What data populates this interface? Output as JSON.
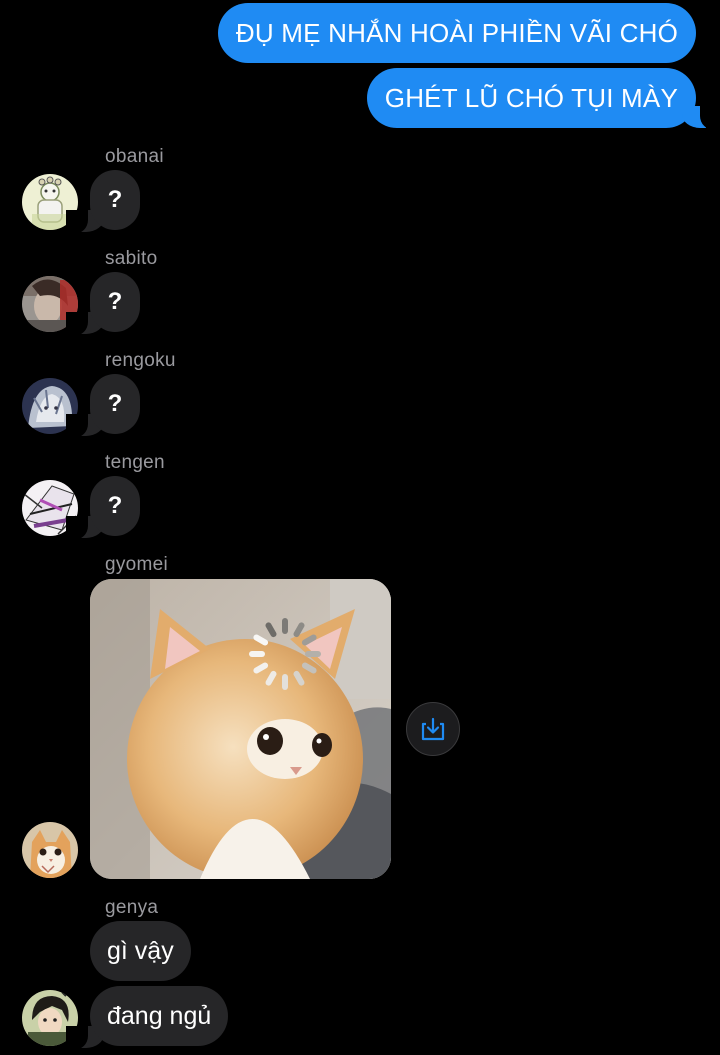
{
  "outgoing_messages": [
    "ĐỤ MẸ NHẮN HOÀI PHIỀN VÃI CHÓ",
    "GHÉT LŨ CHÓ TỤI MÀY"
  ],
  "incoming_groups": [
    {
      "sender": "obanai",
      "text": "?",
      "avatar_icon": "obanai-avatar"
    },
    {
      "sender": "sabito",
      "text": "?",
      "avatar_icon": "sabito-avatar"
    },
    {
      "sender": "rengoku",
      "text": "?",
      "avatar_icon": "rengoku-avatar"
    },
    {
      "sender": "tengen",
      "text": "?",
      "avatar_icon": "tengen-avatar"
    }
  ],
  "gyomei": {
    "sender": "gyomei",
    "attachment": "cat-photo",
    "save_icon": "save-to-device-icon"
  },
  "genya": {
    "sender": "genya",
    "messages": [
      "gì vậy",
      "đang ngủ"
    ]
  },
  "colors": {
    "outgoing_bubble": "#1f8bf3",
    "incoming_bubble": "#262628",
    "background": "#000000",
    "sender_label": "#9a9a9f"
  }
}
